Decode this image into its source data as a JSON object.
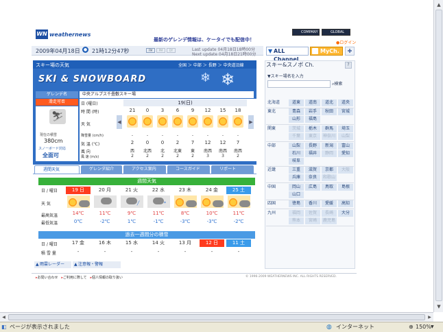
{
  "header": {
    "logo_mark": "WN",
    "logo_text": "weathernews",
    "promo": "最新のゲレンデ情報は、ケータイでも配信中！",
    "company_btn": "COMPANY",
    "global_btn": "GLOBAL",
    "login_link": "ログイン",
    "date": "2009年04月18日",
    "time": "21時12分47秒",
    "small_btns": [
      "FM",
      "PM",
      "DY"
    ],
    "last_update": "Last update  04月18日18時00分",
    "next_update": "Next update  04月18日21時00分",
    "all_channel": "ALL Channel",
    "my_channel": "MyCh."
  },
  "ski": {
    "section_title": "スキー場の天気",
    "breadcrumb": [
      "全国",
      "中部",
      "長野",
      "中央道沿線"
    ],
    "banner": "SKI & SNOWBOARD",
    "resort_label": "ゲレンデ名",
    "resort_name": "中央アルプス千畳敷スキー場",
    "status": "滑走可否",
    "snow_label": "現在の積雪",
    "snow_value": "380cm",
    "snowboard_label": "スノーボード対応",
    "snowboard_value": "全面可",
    "row_labels": [
      "日 (曜日)",
      "時 間 (時)",
      "天 気",
      "降雪量 (cm/h)",
      "気 温 (℃)",
      "風 向",
      "風 速 (m/s)"
    ],
    "day_header": "19(日)",
    "hours": [
      "21",
      "0",
      "3",
      "6",
      "9",
      "12",
      "15",
      "18"
    ],
    "snowfall": [
      "-",
      "-",
      "-",
      "-",
      "-",
      "-",
      "-",
      "-"
    ],
    "temps": [
      "2",
      "0",
      "0",
      "2",
      "7",
      "12",
      "12",
      "7"
    ],
    "wind_dir": [
      "西",
      "北西",
      "北",
      "北東",
      "東",
      "南西",
      "南西",
      "南西"
    ],
    "wind_speed": [
      "2",
      "2",
      "2",
      "2",
      "2",
      "3",
      "3",
      "2"
    ]
  },
  "tabs": [
    "週間天気",
    "ゲレンダ紹介",
    "アクセス案内",
    "コースガイド",
    "リポート"
  ],
  "weekly": {
    "title": "週間天気",
    "day_label": "日 / 曜日",
    "days": [
      "19 日",
      "20 月",
      "21 火",
      "22 水",
      "23 木",
      "24 金",
      "25 土"
    ],
    "weather_label": "天 気",
    "max_label": "最高気温",
    "min_label": "最低気温",
    "max": [
      "14℃",
      "11℃",
      "9℃",
      "11℃",
      "8℃",
      "10℃",
      "11℃"
    ],
    "min": [
      "0℃",
      "-2℃",
      "1℃",
      "-1℃",
      "-3℃",
      "-3℃",
      "-2℃"
    ]
  },
  "history": {
    "title": "過去一週間分の積雪",
    "day_label": "日 / 曜日",
    "days": [
      "17 金",
      "16 木",
      "15 水",
      "14 火",
      "13 月",
      "12 日",
      "11 土"
    ],
    "snow_label": "積 雪 量",
    "snow": [
      "-",
      "-",
      "-",
      "-",
      "-",
      "-",
      "-"
    ]
  },
  "bottom_links": [
    "雨雲レーダー",
    "注意報・警報"
  ],
  "sidebar": {
    "title": "スキー&スノボ Ch.",
    "search_label": "スキー場名を入力",
    "search_button": "検索",
    "regions": [
      {
        "name": "北海道",
        "areas": [
          "道東",
          "道南",
          "道北",
          "道央"
        ]
      },
      {
        "name": "東北",
        "areas": [
          "青森",
          "岩手",
          "秋田",
          "宮城",
          "山形",
          "福島"
        ]
      },
      {
        "name": "関東",
        "areas": [
          "茨城",
          "栃木",
          "群馬",
          "埼玉",
          "千葉",
          "東京",
          "神奈川",
          "山梨"
        ]
      },
      {
        "name": "中部",
        "areas": [
          "山梨",
          "長野",
          "新潟",
          "富山",
          "石川",
          "福井",
          "静岡",
          "愛知",
          "岐阜"
        ]
      },
      {
        "name": "近畿",
        "areas": [
          "三重",
          "滋賀",
          "京都",
          "大阪",
          "兵庫",
          "奈良",
          "和歌山"
        ]
      },
      {
        "name": "中国",
        "areas": [
          "岡山",
          "広島",
          "鳥取",
          "島根",
          "山口"
        ]
      },
      {
        "name": "四国",
        "areas": [
          "徳島",
          "香川",
          "愛媛",
          "高知"
        ]
      },
      {
        "name": "九州",
        "areas": [
          "福岡",
          "佐賀",
          "長崎",
          "大分",
          "熊本",
          "宮崎",
          "鹿児島"
        ]
      }
    ]
  },
  "footer": {
    "links": [
      "お問い合わせ",
      "ご利用に際して",
      "個人情報の取り扱い"
    ],
    "copyright": "© 1996-2009 WEATHERNEWS INC. ALL RIGHTS RESERVED."
  },
  "statusbar": {
    "message": "ページが表示されました",
    "zone": "インターネット",
    "zoom": "150%"
  },
  "colors": {
    "header_blue": "#1f5fb8",
    "panel_blue": "#4b82c8",
    "green_bar": "#37b13a",
    "red_day": "#ff3b1e",
    "sat_blue": "#3a9bea"
  }
}
